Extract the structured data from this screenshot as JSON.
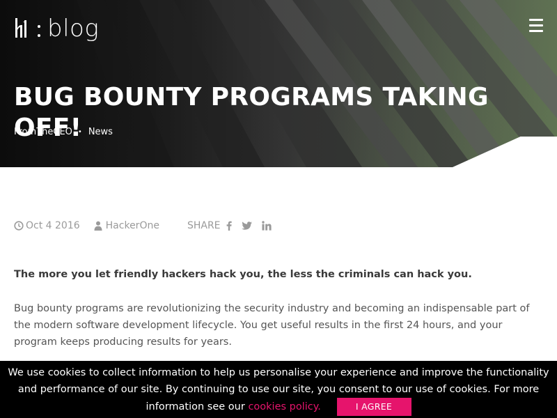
{
  "header": {
    "logo_text": "blog",
    "menu_icon": "hamburger-icon"
  },
  "post": {
    "title": "BUG BOUNTY PROGRAMS TAKING OFF!",
    "categories": [
      "FromTheCEO",
      "News"
    ],
    "separator": "•",
    "date": "Oct 4 2016",
    "author": "HackerOne",
    "share_label": "SHARE",
    "social_icons": [
      "facebook-icon",
      "twitter-icon",
      "linkedin-icon"
    ],
    "lead": "The more you let friendly hackers hack you, the less the criminals can hack you.",
    "paragraph": "Bug bounty programs are revolutionizing the security industry and becoming an indispensable part of the modern software development lifecycle. You get useful results in the first 24 hours, and your program keeps producing results for years."
  },
  "cookie_bar": {
    "text": "We use cookies to collect information to help us personalise your experience and improve the functionality and performance of our site. By continuing to use our site, you consent to our use of cookies. For more information see our",
    "policy_link": "cookies policy.",
    "agree_label": "I AGREE"
  },
  "colors": {
    "accent": "#e6146c",
    "hero_dark": "#1b1b1b",
    "meta_text": "#9a9a9a"
  }
}
